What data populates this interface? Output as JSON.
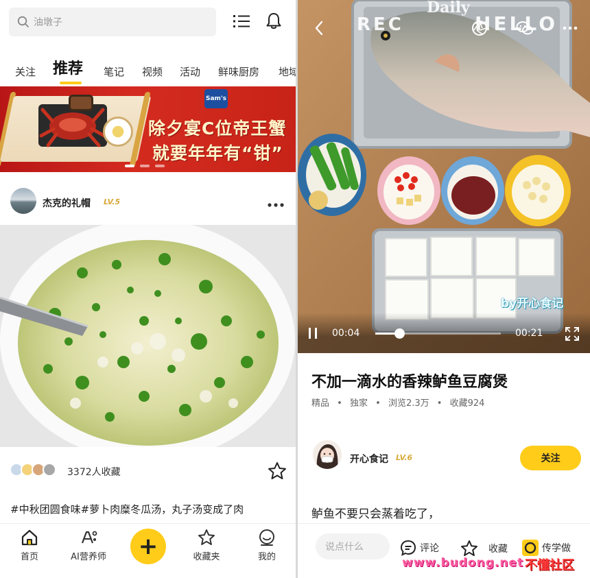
{
  "left": {
    "search": {
      "placeholder": "油墩子"
    },
    "tabs": [
      "关注",
      "推荐",
      "笔记",
      "视频",
      "活动",
      "鲜味厨房",
      "地域"
    ],
    "active_tab_index": 1,
    "banner": {
      "line1": "除夕宴C位帝王蟹",
      "line2": "就要年年有“钳”",
      "logo": "Sam's",
      "slide_count": 3,
      "active_slide": 1
    },
    "post": {
      "author": "杰克的礼帽",
      "level": "LV.5",
      "favorites_text": "3372人收藏",
      "description": "#中秋团圆食味#萝卜肉糜冬瓜汤，丸子汤变成了肉"
    },
    "nav": [
      {
        "label": "首页",
        "icon": "home-icon"
      },
      {
        "label": "AI营养师",
        "icon": "ai-nutritionist-icon"
      },
      {
        "label": "收藏夹",
        "icon": "star-icon"
      },
      {
        "label": "我的",
        "icon": "profile-icon"
      }
    ],
    "fab_label": "+"
  },
  "right": {
    "video": {
      "current_time": "00:04",
      "duration": "00:21",
      "progress_fraction": 0.19,
      "overlay_text": {
        "rec": "REC",
        "daily": "Daily",
        "hello": "HELLO"
      },
      "watermark": "by开心食记"
    },
    "title": "不加一滴水的香辣鲈鱼豆腐煲",
    "meta": [
      "精品",
      "独家",
      "浏览2.3万",
      "收藏924"
    ],
    "meta_separator": "•",
    "author": {
      "name": "开心食记",
      "level": "LV.6"
    },
    "follow_label": "关注",
    "intro": "鲈鱼不要只会蒸着吃了，",
    "bottom": {
      "comment_placeholder": "说点什么",
      "comment_label": "评论",
      "favorite_label": "收藏",
      "learn_label": "传学做"
    },
    "site_watermark": {
      "url": "www.budong.net",
      "name": "不懂社区"
    }
  }
}
